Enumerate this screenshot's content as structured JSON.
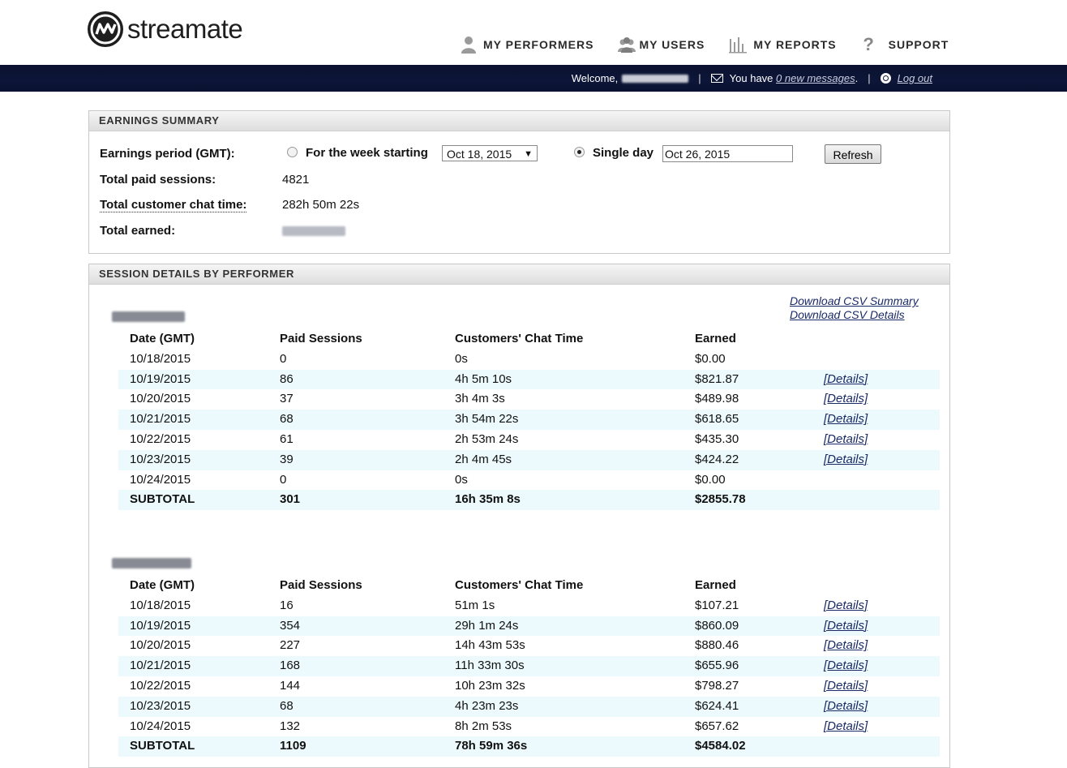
{
  "brand": {
    "name": "streamate"
  },
  "nav": [
    {
      "label": "MY PERFORMERS",
      "icon": "person-icon"
    },
    {
      "label": "MY USERS",
      "icon": "users-icon"
    },
    {
      "label": "MY REPORTS",
      "icon": "bar-chart-icon"
    },
    {
      "label": "SUPPORT",
      "icon": "question-icon"
    }
  ],
  "userbar": {
    "welcome": "Welcome,",
    "you_have": "You have",
    "messages_link": "0 new messages",
    "period": ".",
    "logout": "Log out"
  },
  "summary": {
    "title": "EARNINGS SUMMARY",
    "period_label": "Earnings period (GMT):",
    "week_label": "For the week starting",
    "week_value": "Oct 18, 2015",
    "single_label": "Single day",
    "single_value": "Oct 26, 2015",
    "refresh": "Refresh",
    "sessions_label": "Total paid sessions:",
    "sessions_value": "4821",
    "chat_label": "Total customer chat time:",
    "chat_value": "282h 50m 22s",
    "earned_label": "Total earned:"
  },
  "details": {
    "title": "SESSION DETAILS BY PERFORMER",
    "csv_summary": "Download CSV Summary",
    "csv_details": "Download CSV Details",
    "columns": [
      "Date (GMT)",
      "Paid Sessions",
      "Customers' Chat Time",
      "Earned"
    ],
    "details_link": "[Details]",
    "performers": [
      {
        "rows": [
          [
            "10/18/2015",
            "0",
            "0s",
            "$0.00",
            false
          ],
          [
            "10/19/2015",
            "86",
            "4h 5m 10s",
            "$821.87",
            true
          ],
          [
            "10/20/2015",
            "37",
            "3h 4m 3s",
            "$489.98",
            true
          ],
          [
            "10/21/2015",
            "68",
            "3h 54m 22s",
            "$618.65",
            true
          ],
          [
            "10/22/2015",
            "61",
            "2h 53m 24s",
            "$435.30",
            true
          ],
          [
            "10/23/2015",
            "39",
            "2h 4m 45s",
            "$424.22",
            true
          ],
          [
            "10/24/2015",
            "0",
            "0s",
            "$0.00",
            false
          ]
        ],
        "subtotal": [
          "SUBTOTAL",
          "301",
          "16h 35m 8s",
          "$2855.78"
        ]
      },
      {
        "rows": [
          [
            "10/18/2015",
            "16",
            "51m 1s",
            "$107.21",
            true
          ],
          [
            "10/19/2015",
            "354",
            "29h 1m 24s",
            "$860.09",
            true
          ],
          [
            "10/20/2015",
            "227",
            "14h 43m 53s",
            "$880.46",
            true
          ],
          [
            "10/21/2015",
            "168",
            "11h 33m 30s",
            "$655.96",
            true
          ],
          [
            "10/22/2015",
            "144",
            "10h 23m 32s",
            "$798.27",
            true
          ],
          [
            "10/23/2015",
            "68",
            "4h 23m 23s",
            "$624.41",
            true
          ],
          [
            "10/24/2015",
            "132",
            "8h 2m 53s",
            "$657.62",
            true
          ]
        ],
        "subtotal": [
          "SUBTOTAL",
          "1109",
          "78h 59m 36s",
          "$4584.02"
        ]
      }
    ]
  }
}
